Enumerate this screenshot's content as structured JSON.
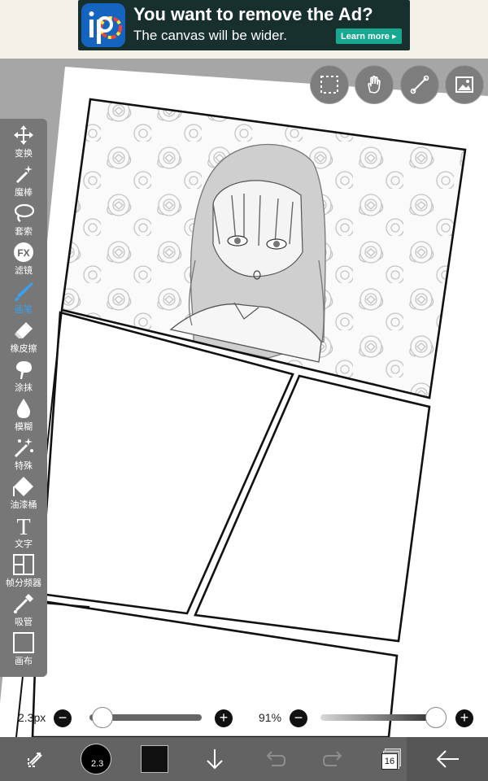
{
  "ad": {
    "title": "You want to remove the Ad?",
    "subtitle": "The canvas will be wider.",
    "button": "Learn more ▸"
  },
  "top_tools": [
    "selection-icon",
    "hand-icon",
    "ruler-icon",
    "image-icon"
  ],
  "left_toolbar": {
    "items": [
      {
        "label": "变换",
        "icon": "move-icon"
      },
      {
        "label": "魔棒",
        "icon": "magic-wand-icon"
      },
      {
        "label": "套索",
        "icon": "lasso-icon"
      },
      {
        "label": "滤镜",
        "icon": "filter-fx-icon",
        "glyph": "FX"
      },
      {
        "label": "画笔",
        "icon": "brush-icon",
        "active": true
      },
      {
        "label": "橡皮擦",
        "icon": "eraser-icon"
      },
      {
        "label": "涂抹",
        "icon": "smudge-icon"
      },
      {
        "label": "模糊",
        "icon": "blur-icon"
      },
      {
        "label": "特殊",
        "icon": "special-icon"
      },
      {
        "label": "油漆桶",
        "icon": "bucket-icon"
      },
      {
        "label": "文字",
        "icon": "text-icon",
        "glyph": "T"
      },
      {
        "label": "帧分频器",
        "icon": "frame-divider-icon"
      },
      {
        "label": "吸管",
        "icon": "eyedropper-icon"
      },
      {
        "label": "画布",
        "icon": "canvas-icon"
      }
    ],
    "active_color": "#3aa0ee"
  },
  "brush_size": {
    "value": "2.3px",
    "minus": "−",
    "plus": "+",
    "slider_level": 0.04
  },
  "opacity": {
    "value": "91%",
    "minus": "−",
    "plus": "+",
    "slider_level": 0.91
  },
  "bottom_bar": {
    "brush_size_badge": "2.3",
    "color": "#111111",
    "layer_count": "16",
    "icons": [
      "swap-icon",
      "brush-size-icon",
      "color-swatch-icon",
      "download-icon",
      "undo-icon",
      "redo-icon",
      "layers-icon",
      "back-arrow-icon"
    ]
  }
}
